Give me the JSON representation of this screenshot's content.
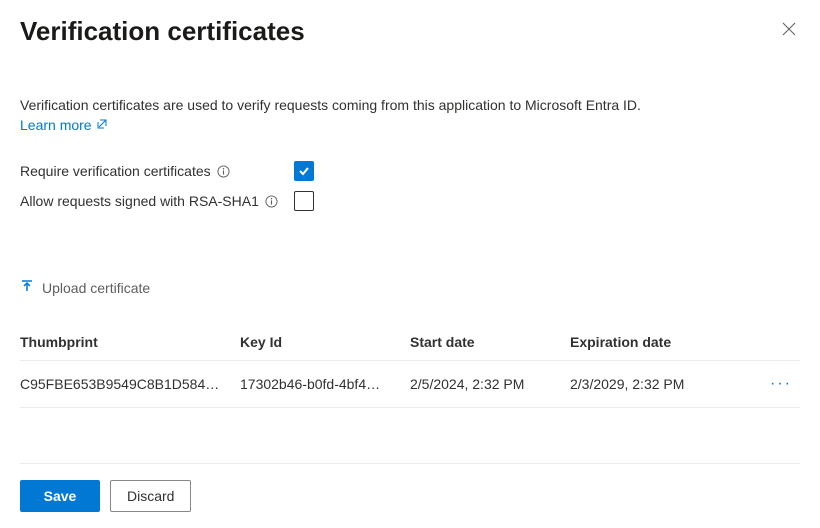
{
  "header": {
    "title": "Verification certificates"
  },
  "description": "Verification certificates are used to verify requests coming from this application to Microsoft Entra ID.",
  "learn_more": "Learn more",
  "settings": {
    "require_label": "Require verification certificates",
    "allow_rsa_label": "Allow requests signed with RSA-SHA1"
  },
  "upload": {
    "label": "Upload certificate"
  },
  "table": {
    "headers": {
      "thumbprint": "Thumbprint",
      "key_id": "Key Id",
      "start": "Start date",
      "expiration": "Expiration date"
    },
    "rows": [
      {
        "thumbprint": "C95FBE653B9549C8B1D584…",
        "key_id": "17302b46-b0fd-4bf4…",
        "start": "2/5/2024, 2:32 PM",
        "expiration": "2/3/2029, 2:32 PM"
      }
    ]
  },
  "footer": {
    "save": "Save",
    "discard": "Discard"
  }
}
